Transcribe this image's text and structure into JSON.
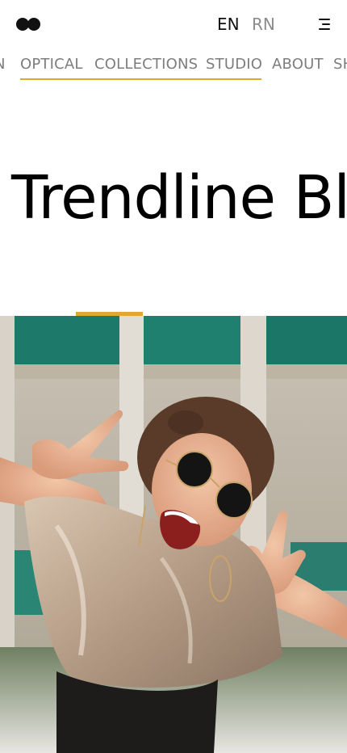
{
  "header": {
    "logo_icon": "two-dots-logo",
    "languages": [
      {
        "code": "EN",
        "active": true
      },
      {
        "code": "RN",
        "active": false
      }
    ],
    "menu_icon": "hamburger-menu-icon"
  },
  "nav": {
    "items": [
      {
        "label": "N"
      },
      {
        "label": "OPTICAL"
      },
      {
        "label": "COLLECTIONS"
      },
      {
        "label": "STUDIO"
      },
      {
        "label": "ABOUT"
      },
      {
        "label": "SH"
      }
    ],
    "accent_color": "#e0a82e"
  },
  "hero": {
    "title": "Trendline Bl",
    "image_description_icon": "photo-woman-sunglasses-peace-sign"
  },
  "colors": {
    "accent": "#e0a82e",
    "text": "#111111",
    "muted": "#7d7d7d"
  }
}
